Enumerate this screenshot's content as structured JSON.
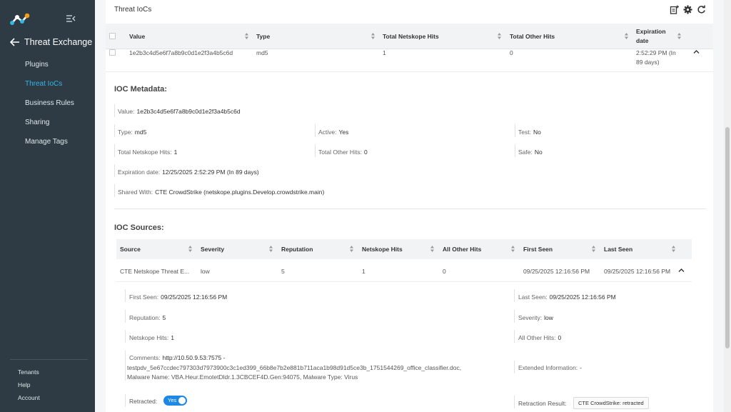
{
  "sidebar": {
    "back_title": "Threat Exchange",
    "items": [
      {
        "label": "Plugins"
      },
      {
        "label": "Threat IoCs"
      },
      {
        "label": "Business Rules"
      },
      {
        "label": "Sharing"
      },
      {
        "label": "Manage Tags"
      }
    ],
    "active_index": 1,
    "bottom_items": [
      {
        "label": "Tenants"
      },
      {
        "label": "Help"
      },
      {
        "label": "Account"
      }
    ]
  },
  "card": {
    "title": "Threat IoCs"
  },
  "table": {
    "columns": [
      "Value",
      "Type",
      "Total Netskope Hits",
      "Total Other Hits",
      "Expiration date"
    ],
    "row": {
      "value": "1e2b3c4d5e6f7a8b9c0d1e2f3a4b5c6d",
      "type": "md5",
      "netskope_hits": "1",
      "other_hits": "0",
      "expiration_line1": "2:52:29 PM (In",
      "expiration_line2": "89 days)"
    }
  },
  "metadata": {
    "title": "IOC Metadata:",
    "value_label": "Value:",
    "value": "1e2b3c4d5e6f7a8b9c0d1e2f3a4b5c6d",
    "type_label": "Type:",
    "type": "md5",
    "active_label": "Active:",
    "active": "Yes",
    "test_label": "Test:",
    "test": "No",
    "netskope_hits_label": "Total Netskope Hits:",
    "netskope_hits": "1",
    "other_hits_label": "Total Other Hits:",
    "other_hits": "0",
    "safe_label": "Safe:",
    "safe": "No",
    "expiration_label": "Expiration date:",
    "expiration": "12/25/2025 2:52:29 PM (In 89 days)",
    "shared_label": "Shared With:",
    "shared": "CTE CrowdStrike (netskope.plugins.Develop.crowdstrike.main)"
  },
  "sources": {
    "title": "IOC Sources:",
    "columns": [
      "Source",
      "Severity",
      "Reputation",
      "Netskope Hits",
      "All Other Hits",
      "First Seen",
      "Last Seen"
    ],
    "row": {
      "source": "CTE Netskope Threat E...",
      "severity": "low",
      "reputation": "5",
      "netskope_hits": "1",
      "other_hits": "0",
      "first_seen": "09/25/2025 12:16:56 PM",
      "last_seen": "09/25/2025 12:16:56 PM"
    },
    "details": {
      "first_seen_label": "First Seen:",
      "first_seen": "09/25/2025 12:16:56 PM",
      "last_seen_label": "Last Seen:",
      "last_seen": "09/25/2025 12:16:56 PM",
      "reputation_label": "Reputation:",
      "reputation": "5",
      "severity_label": "Severity:",
      "severity": "low",
      "netskope_hits_label": "Netskope Hits:",
      "netskope_hits": "1",
      "other_hits_label": "All Other Hits:",
      "other_hits": "0",
      "comments_label": "Comments:",
      "comments_line1": "http://10.50.9.53:7575 -",
      "comments_line2": "testpdv_5e67ccdec797303d7973900c3c1ed399_66b8e7b2e881b711aca1b98d91d5ce3b_1751544269_office_classifier.doc,",
      "comments_line3": "Malware Name: VBA.Heur.EmotetDldr.1.3CBCEF4D.Gen:94075, Malware Type: Virus",
      "extended_label": "Extended Information:",
      "extended": "-",
      "retracted_label": "Retracted:",
      "retracted_toggle": "Yes",
      "retraction_result_label": "Retraction Result:",
      "retraction_result": "CTE CrowdStrike: retracted"
    }
  },
  "colors": {
    "sidebar_bg": "#2e3b44",
    "accent": "#35b6e8",
    "toggle_on": "#1e88e5"
  }
}
